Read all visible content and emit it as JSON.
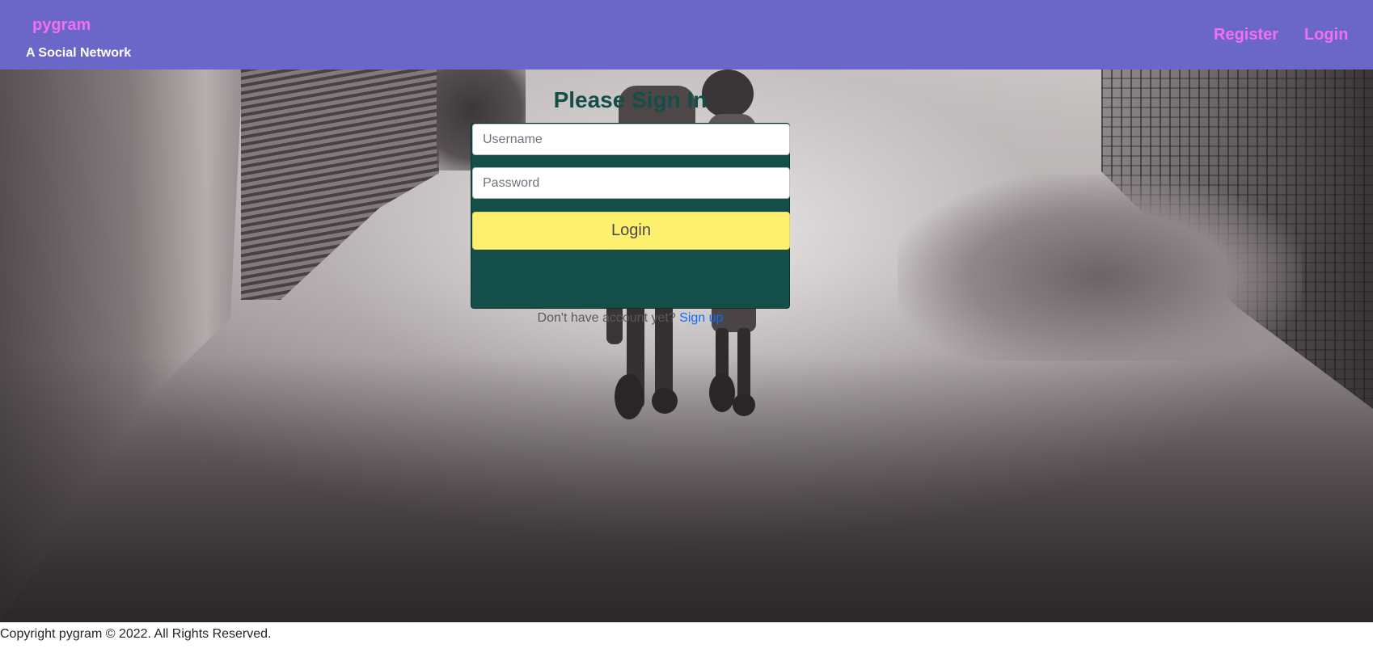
{
  "header": {
    "brand": "pygram",
    "tagline": "A Social Network",
    "nav": {
      "register": "Register",
      "login": "Login"
    }
  },
  "signin": {
    "title": "Please Sign In",
    "username_placeholder": "Username",
    "password_placeholder": "Password",
    "login_button": "Login",
    "signup_prompt": "Don't have account yet?",
    "signup_link": "Sign up"
  },
  "footer": {
    "copyright": "Copyright pygram © 2022. All Rights Reserved."
  },
  "colors": {
    "navbar_bg": "#6a67c8",
    "brand_pink": "#f46ff0",
    "card_bg": "#134e48",
    "button_yellow": "#fdf06e",
    "link_blue": "#0d6efd"
  }
}
